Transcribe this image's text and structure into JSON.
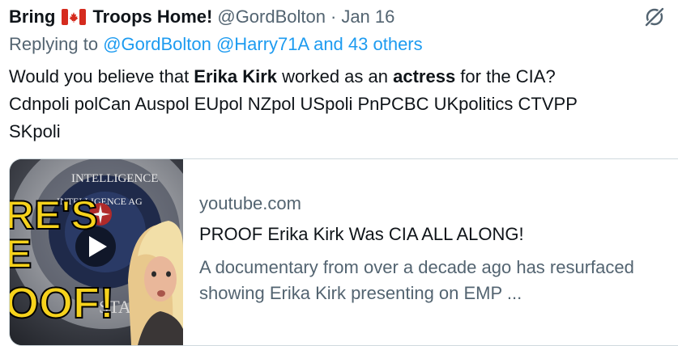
{
  "tweet": {
    "name_part1": "Bring",
    "name_part2": "Troops Home!",
    "flag_icon": "canada-flag-icon",
    "handle": "@GordBolton",
    "separator": "·",
    "date": "Jan 16",
    "replying_prefix": "Replying to",
    "replying_users": "@GordBolton @Harry71A and 43 others",
    "text_part1": "Would you believe that ",
    "text_bold1": "Erika Kirk",
    "text_part2": " worked as an ",
    "text_bold2": "actress",
    "text_part3": " for the CIA?",
    "text_line2": "Cdnpoli polCan Auspol EUpol NZpol USpoli PnPCBC UKpolitics CTVPP",
    "text_line3": "SKpoli"
  },
  "card": {
    "domain": "youtube.com",
    "title": "PROOF Erika Kirk Was CIA ALL ALONG!",
    "description": "A documentary from over a decade ago has resurfaced showing Erika Kirk presenting on EMP ...",
    "thumbnail": {
      "overlay_line1": "RE'S",
      "overlay_line2": "E",
      "overlay_line3": "OOF!",
      "seal_top_text": "INTELLIGENCE",
      "seal_mid_text": "INTELLIGENCE AG",
      "seal_bottom_text": "STATES"
    }
  },
  "colors": {
    "text_primary": "#0f1419",
    "text_secondary": "#536471",
    "link": "#1d9bf0",
    "border": "#cfd9de",
    "thumb_yellow": "#f6d21c"
  },
  "icons": {
    "grok": "grok-icon",
    "play": "play-icon"
  }
}
